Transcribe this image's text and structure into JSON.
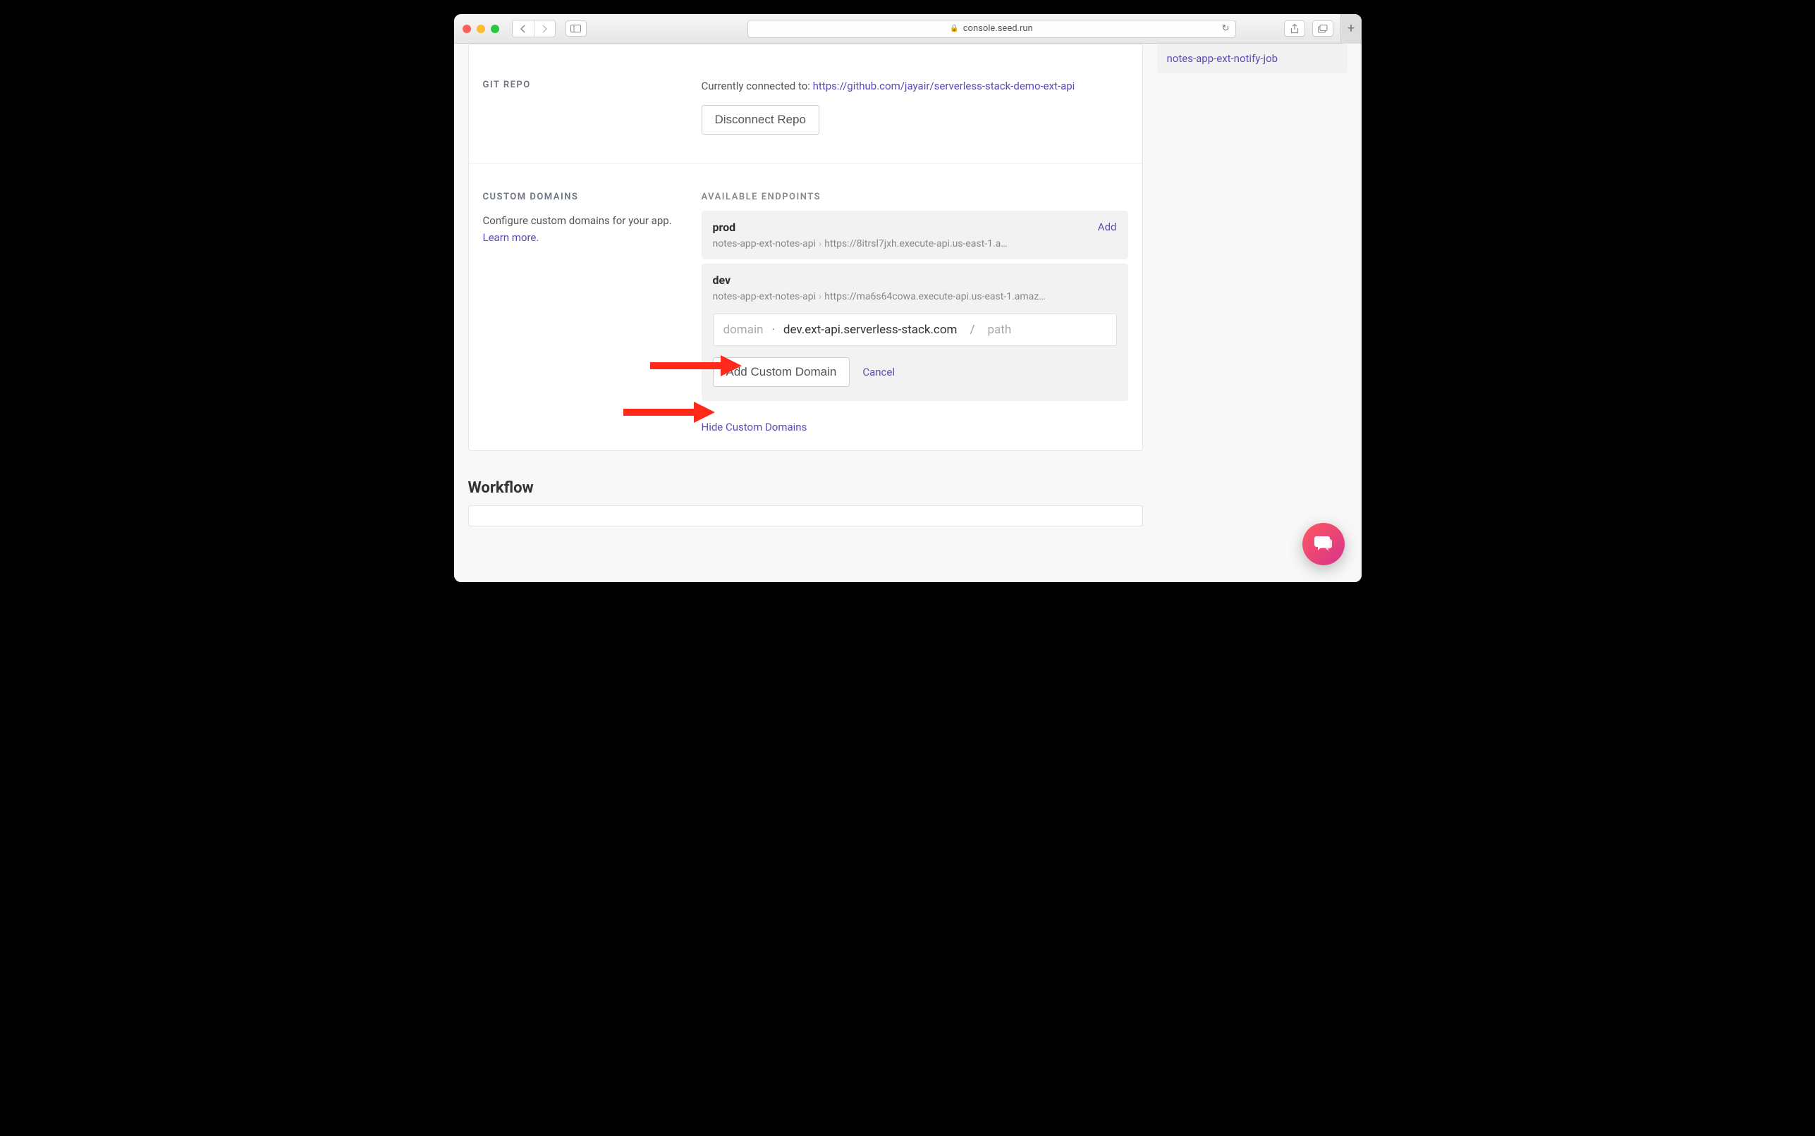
{
  "browser": {
    "address": "console.seed.run"
  },
  "sidebar": {
    "item": "notes-app-ext-notify-job"
  },
  "git_repo": {
    "title": "GIT REPO",
    "connected_text": "Currently connected to: ",
    "repo_url": "https://github.com/jayair/serverless-stack-demo-ext-api",
    "disconnect_label": "Disconnect Repo"
  },
  "custom_domains": {
    "title": "CUSTOM DOMAINS",
    "desc_text": "Configure custom domains for your app. ",
    "learn_more": "Learn more.",
    "available_heading": "AVAILABLE ENDPOINTS",
    "endpoints": [
      {
        "name": "prod",
        "service": "notes-app-ext-notes-api",
        "url": "https://8itrsl7jxh.execute-api.us-east-1.a…",
        "add_label": "Add"
      },
      {
        "name": "dev",
        "service": "notes-app-ext-notes-api",
        "url": "https://ma6s64cowa.execute-api.us-east-1.amaz…"
      }
    ],
    "domain_input": {
      "subdomain_placeholder": "domain",
      "domain_value": "dev.ext-api.serverless-stack.com",
      "path_placeholder": "path"
    },
    "add_button": "Add Custom Domain",
    "cancel_label": "Cancel",
    "hide_label": "Hide Custom Domains"
  },
  "workflow": {
    "title": "Workflow"
  }
}
